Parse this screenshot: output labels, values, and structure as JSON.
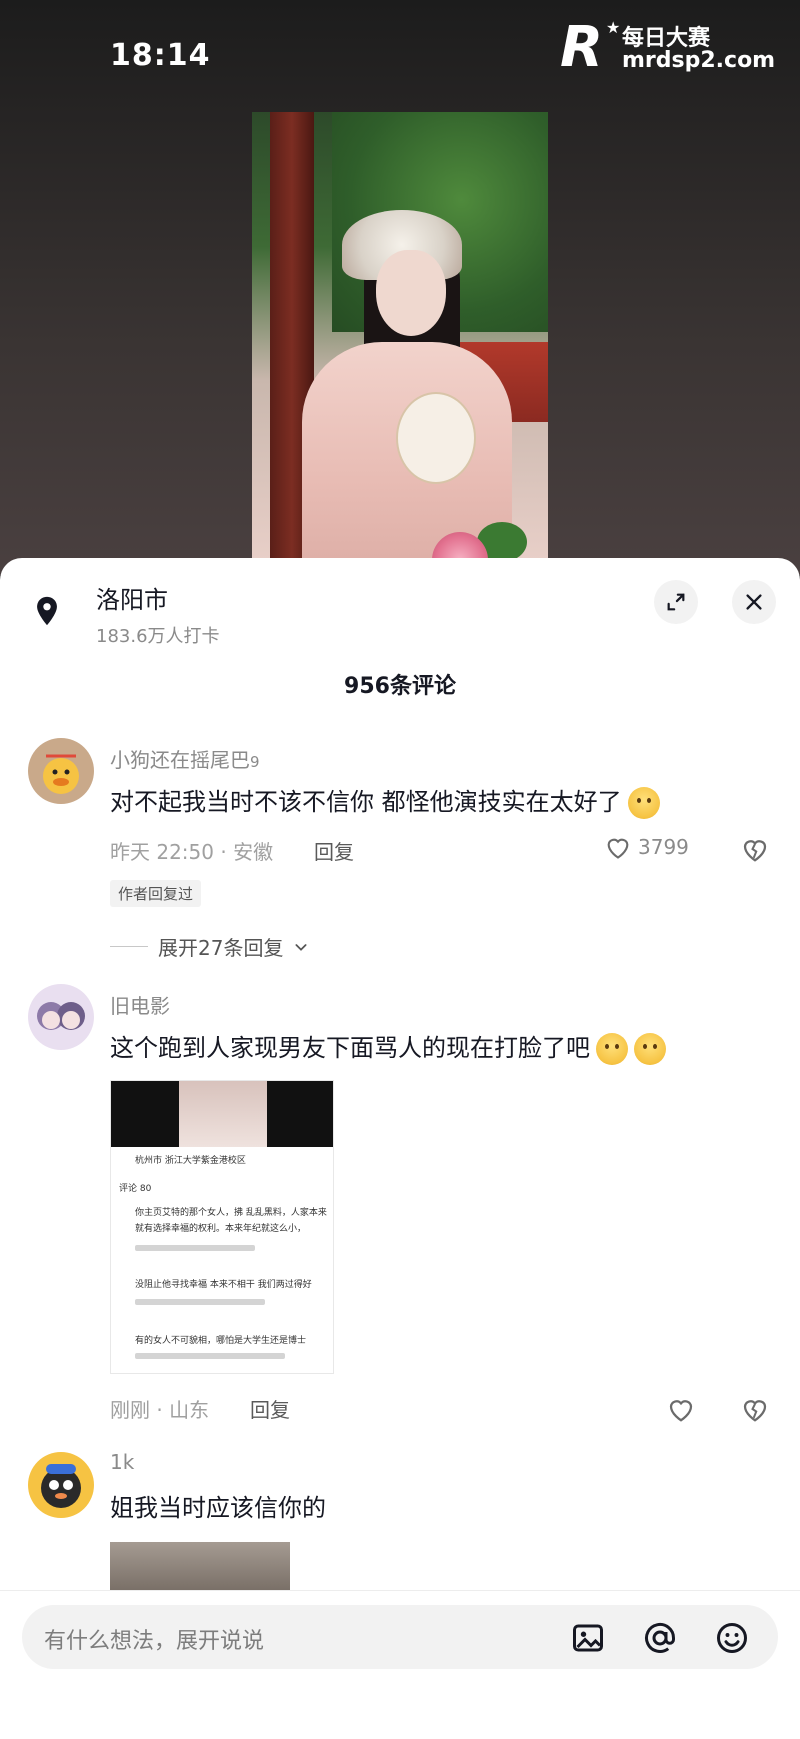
{
  "status_bar": {
    "time": "18:14"
  },
  "watermark": {
    "brand_cn": "每日大赛",
    "url": "mrdsp2.com",
    "logo_letter": "R"
  },
  "location": {
    "name": "洛阳市",
    "checkins": "183.6万人打卡"
  },
  "comments_header": {
    "count_label": "956条评论"
  },
  "comments": [
    {
      "username": "小狗还在摇尾巴",
      "username_suffix": "9",
      "text": "对不起我当时不该不信你 都怪他演技实在太好了",
      "meta": "昨天 22:50 · 安徽",
      "reply_label": "回复",
      "likes": "3799",
      "author_tag": "作者回复过",
      "expand_label": "展开27条回复"
    },
    {
      "username": "旧电影",
      "text": "这个跑到人家现男友下面骂人的现在打脸了吧",
      "meta": "刚刚 · 山东",
      "reply_label": "回复",
      "screenshot": {
        "loc": "杭州市 浙江大学紫金港校区",
        "tab": "评论 80",
        "lines": [
          "你主页艾特的那个女人，拂 乱乱黑料，人家本来",
          "就有选择幸福的权利。本来年纪就这么小，",
          "没阻止他寻找幸福 本来不相干 我们两过得好",
          "有的女人不可貌相，哪怕是大学生还是博士"
        ]
      }
    },
    {
      "username": "1k",
      "text": "姐我当时应该信你的"
    }
  ],
  "input_bar": {
    "placeholder": "有什么想法，展开说说"
  },
  "icons": {
    "location": "location-pin-icon",
    "expand": "expand-icon",
    "close": "close-icon",
    "heart": "heart-icon",
    "dislike": "broken-heart-icon",
    "chevron": "chevron-down-icon",
    "image": "image-icon",
    "at": "at-icon",
    "emoji": "emoji-icon"
  }
}
